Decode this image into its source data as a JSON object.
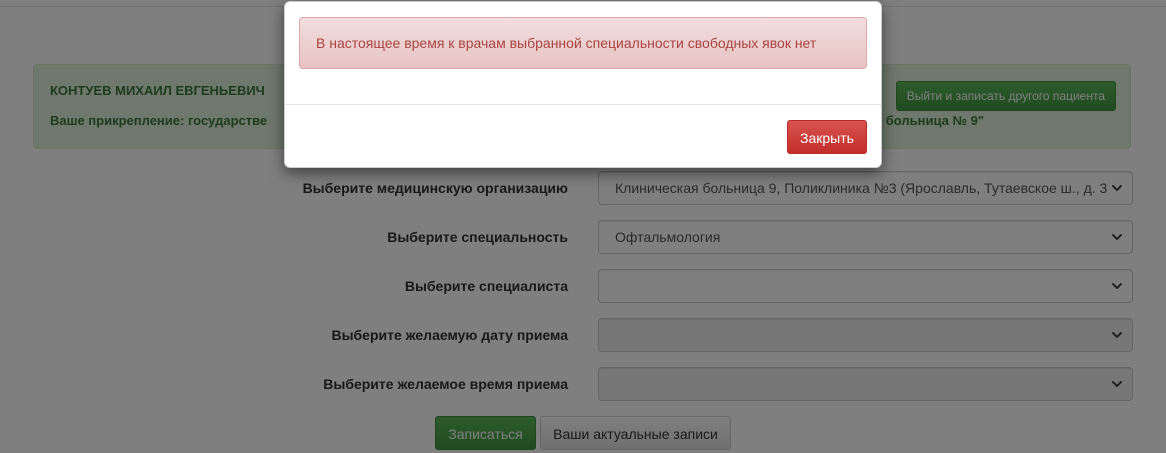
{
  "patient": {
    "name": "КОНТУЕВ МИХАИЛ ЕВГЕНЬЕВИЧ",
    "attachment_start": "Ваше прикрепление: государстве",
    "attachment_end": "больница № 9\"",
    "logout_label": "Выйти и записать другого пациента"
  },
  "form": {
    "rows": [
      {
        "label": "Выберите медицинскую организацию",
        "value": "Клиническая больница 9, Поликлиника №3 (Ярославль, Тутаевское ш., д. 3",
        "disabled": false
      },
      {
        "label": "Выберите специальность",
        "value": "Офтальмология",
        "disabled": false
      },
      {
        "label": "Выберите специалиста",
        "value": "",
        "disabled": false
      },
      {
        "label": "Выберите желаемую дату приема",
        "value": "",
        "disabled": true
      },
      {
        "label": "Выберите желаемое время приема",
        "value": "",
        "disabled": true
      }
    ]
  },
  "actions": {
    "submit_label": "Записаться",
    "records_label": "Ваши актуальные записи"
  },
  "modal": {
    "message": "В настоящее время к врачам выбранной специальности свободных явок нет",
    "close_label": "Закрыть"
  },
  "colors": {
    "success": "#449d44",
    "danger": "#d9534f",
    "alert_text": "#a94442",
    "panel_bg": "#dff0d8"
  },
  "icons": {
    "select_arrow": "chevron-down-icon"
  }
}
